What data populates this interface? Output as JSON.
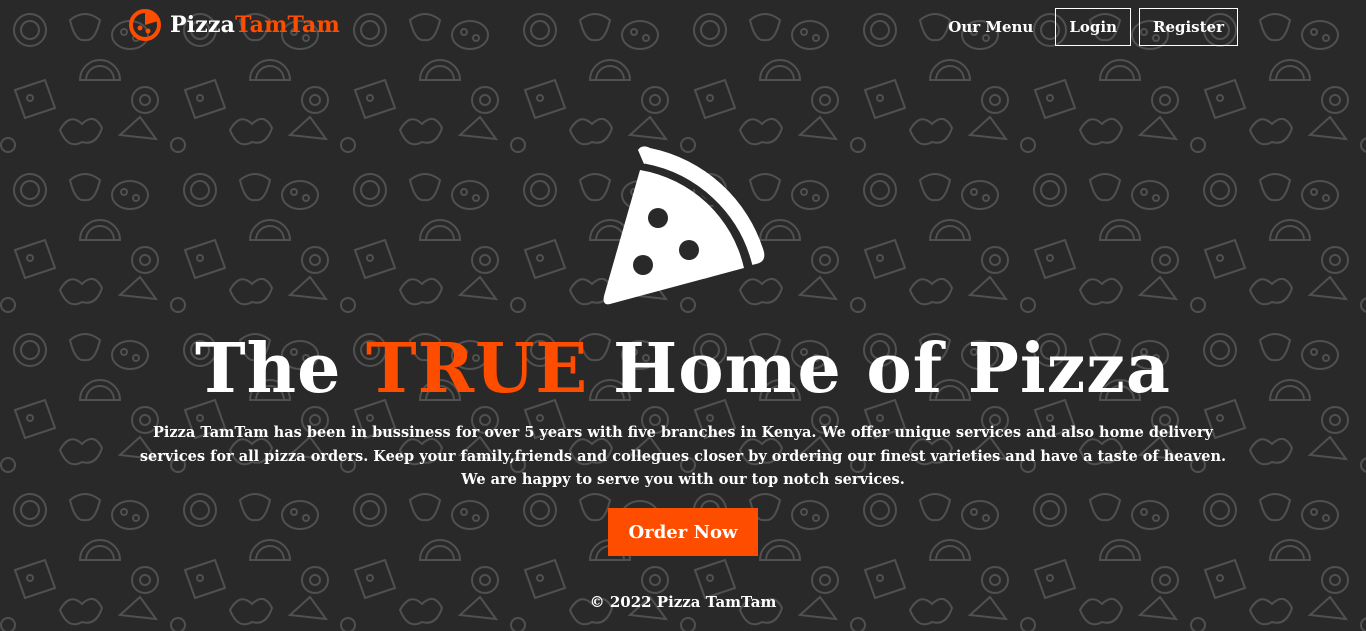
{
  "brand": {
    "name_part1": "Pizza",
    "name_part2": "TamTam",
    "icon": "pizza-icon"
  },
  "nav": {
    "menu_label": "Our Menu",
    "login_label": "Login",
    "register_label": "Register"
  },
  "hero": {
    "icon": "pizza-slice-icon",
    "headline_before": "The ",
    "headline_accent": "TRUE",
    "headline_after": " Home of Pizza",
    "description": "Pizza TamTam has been in bussiness for over 5 years with five branches in Kenya. We offer unique services and also home delivery services for all pizza orders. Keep your family,friends and collegues closer by ordering our finest varieties and have a taste of heaven. We are happy to serve you with our top notch services.",
    "cta_label": "Order Now"
  },
  "footer": {
    "text": "© 2022 Pizza TamTam"
  },
  "colors": {
    "background": "#2a2929",
    "accent": "#ff4d00",
    "text": "#ffffff"
  }
}
